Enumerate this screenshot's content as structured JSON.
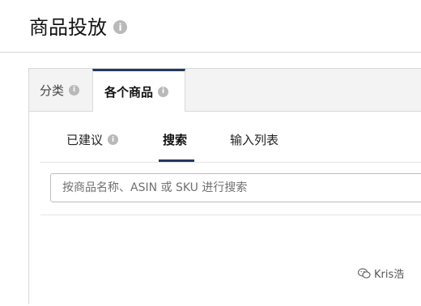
{
  "page": {
    "title": "商品投放",
    "info_glyph": "i"
  },
  "tabs": [
    {
      "label": "分类",
      "active": false
    },
    {
      "label": "各个商品",
      "active": true
    }
  ],
  "subtabs": [
    {
      "label": "已建议",
      "active": false,
      "has_info": true
    },
    {
      "label": "搜索",
      "active": true,
      "has_info": false
    },
    {
      "label": "输入列表",
      "active": false,
      "has_info": false
    }
  ],
  "search": {
    "value": "",
    "placeholder": "按商品名称、ASIN 或 SKU 进行搜索"
  },
  "watermark": {
    "text": "Kris浩",
    "icon": "wechat-icon"
  },
  "colors": {
    "accent": "#23395d",
    "info_icon": "#b9b9b9",
    "tabbar_bg": "#f3f3f3"
  }
}
